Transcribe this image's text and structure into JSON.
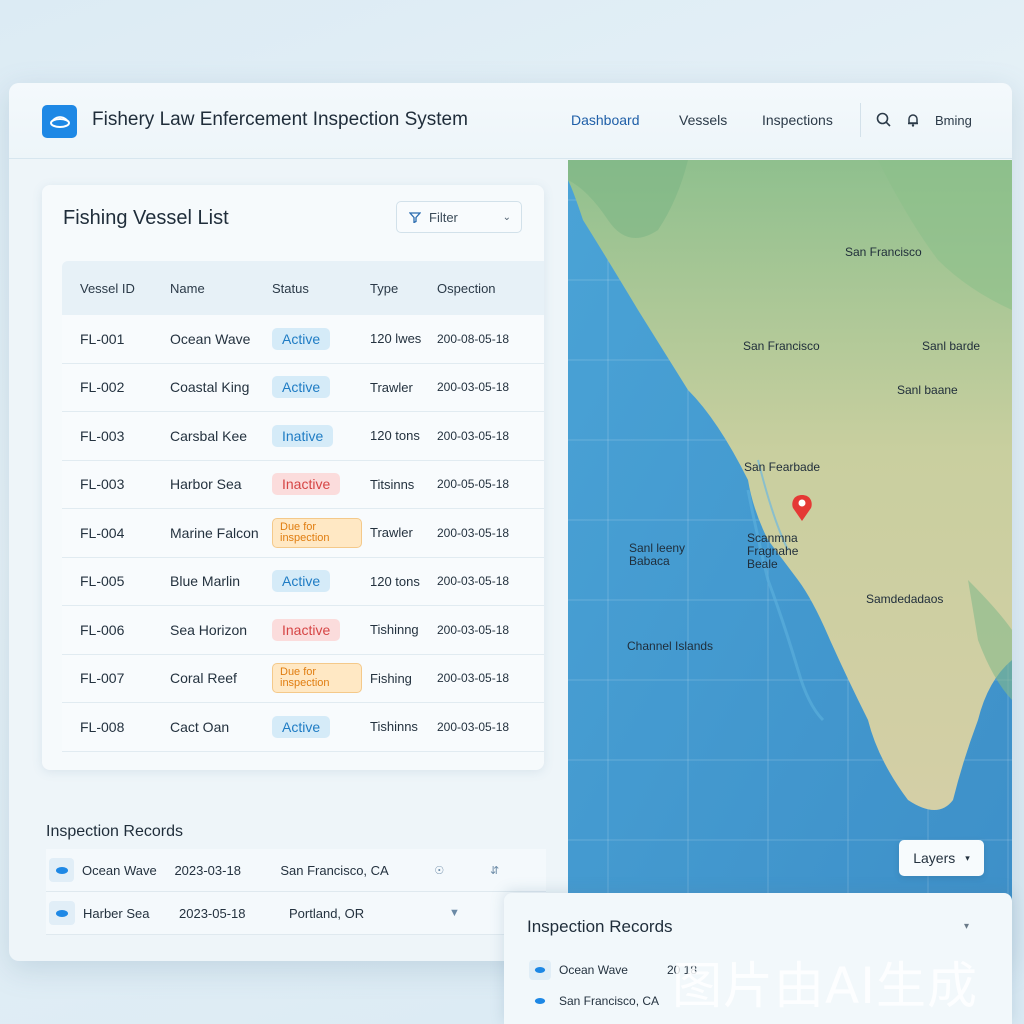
{
  "header": {
    "app_title": "Fishery Law Enfercement Inspection System",
    "nav": [
      "Dashboard",
      "Vessels",
      "Inspections"
    ],
    "user": "Bming"
  },
  "vessel_list": {
    "title": "Fishing Vessel List",
    "filter_label": "Filter",
    "columns": [
      "Vessel ID",
      "Name",
      "Status",
      "Type",
      "Ospection"
    ],
    "rows": [
      {
        "id": "FL-001",
        "name": "Ocean Wave",
        "status": "Active",
        "status_kind": "active",
        "type": "120 lwes",
        "date": "200-08-05-18"
      },
      {
        "id": "FL-002",
        "name": "Coastal King",
        "status": "Active",
        "status_kind": "active",
        "type": "Trawler",
        "date": "200-03-05-18"
      },
      {
        "id": "FL-003",
        "name": "Carsbal Kee",
        "status": "Inative",
        "status_kind": "active",
        "type": "120 tons",
        "date": "200-03-05-18"
      },
      {
        "id": "FL-003",
        "name": "Harbor Sea",
        "status": "Inactive",
        "status_kind": "inactive",
        "type": "Titsinns",
        "date": "200-05-05-18"
      },
      {
        "id": "FL-004",
        "name": "Marine Falcon",
        "status": "Due for inspection",
        "status_kind": "due",
        "type": "Trawler",
        "date": "200-03-05-18"
      },
      {
        "id": "FL-005",
        "name": "Blue Marlin",
        "status": "Active",
        "status_kind": "active",
        "type": "120 tons",
        "date": "200-03-05-18"
      },
      {
        "id": "FL-006",
        "name": "Sea Horizon",
        "status": "Inactive",
        "status_kind": "inactive",
        "type": "Tishinng",
        "date": "200-03-05-18"
      },
      {
        "id": "FL-007",
        "name": "Coral Reef",
        "status": "Due for inspection",
        "status_kind": "due",
        "type": "Fishing",
        "date": "200-03-05-18"
      },
      {
        "id": "FL-008",
        "name": "Cact Oan",
        "status": "Active",
        "status_kind": "active",
        "type": "Tishinns",
        "date": "200-03-05-18"
      }
    ]
  },
  "records": {
    "title": "Inspection Records",
    "rows": [
      {
        "name": "Ocean Wave",
        "date": "2023-03-18",
        "location": "San Francisco, CA"
      },
      {
        "name": "Harber Sea",
        "date": "2023-05-18",
        "location": "Portland, OR"
      }
    ]
  },
  "map": {
    "labels": [
      "San Francisco",
      "San Francisco",
      "Sanl barde",
      "Sanl baane",
      "San Fearbade",
      "Scanmna Fragnahe Beale",
      "Sanl leeny Babaca",
      "Samdedadaos",
      "Channel Islands"
    ],
    "layers_label": "Layers",
    "marker_color": "#e53935"
  },
  "float_panel": {
    "title": "Inspection Records",
    "rows": [
      {
        "name": "Ocean Wave",
        "date": "20 18"
      },
      {
        "name": "San Francisco, CA",
        "date": ""
      }
    ]
  },
  "watermark": "图片由AI生成",
  "colors": {
    "accent": "#1e88e5",
    "active": "#1f7cc4",
    "inactive": "#d64545",
    "due": "#e07d10"
  }
}
